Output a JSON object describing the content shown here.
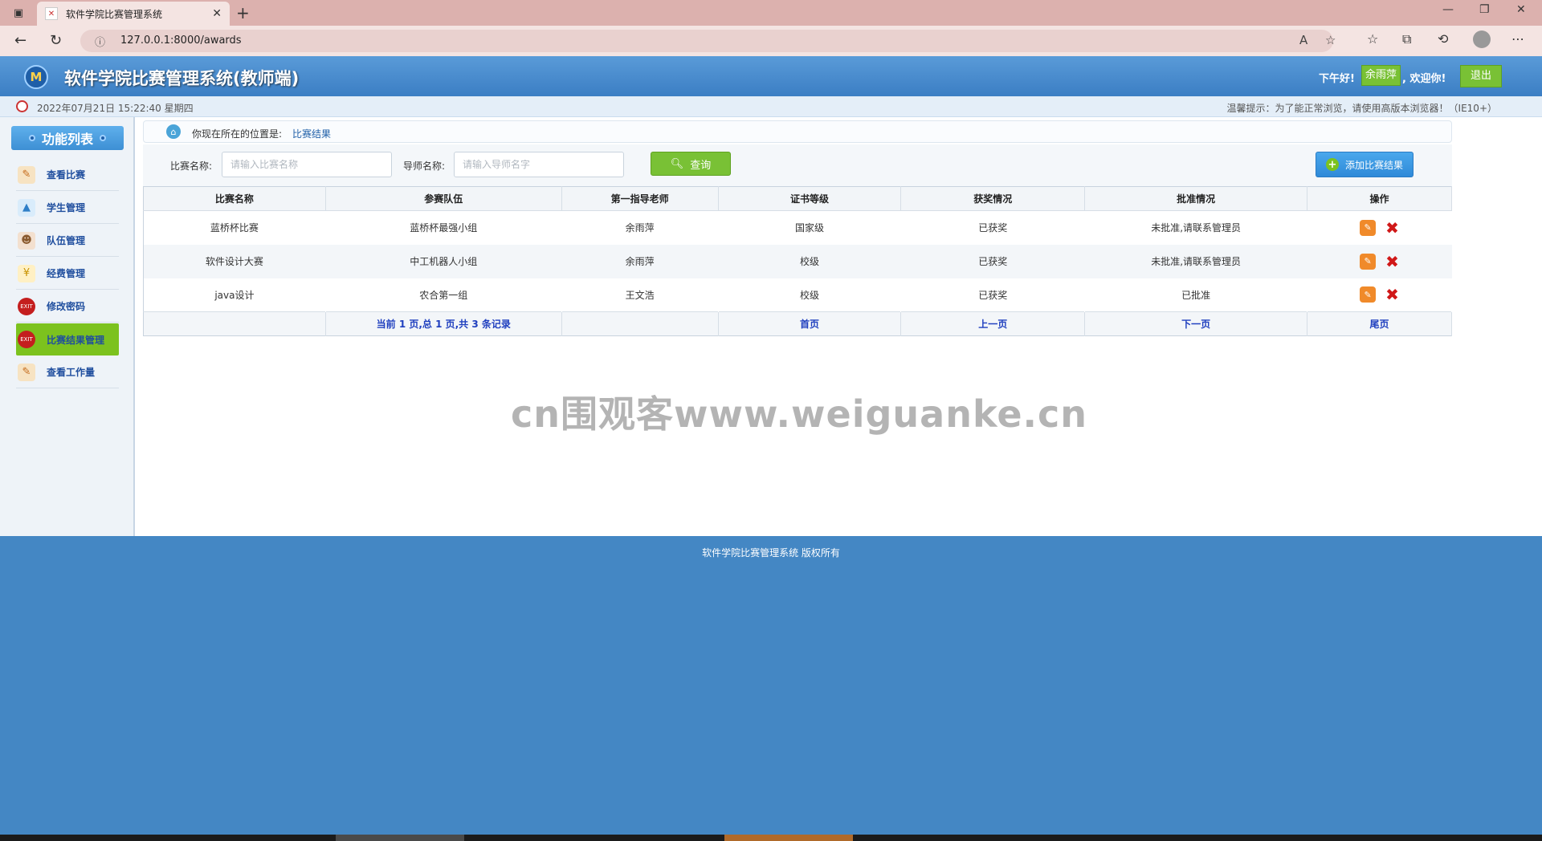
{
  "browser": {
    "tab_title": "软件学院比赛管理系统",
    "url": "127.0.0.1:8000/awards"
  },
  "header": {
    "logo_text": "M",
    "title": "软件学院比赛管理系统(教师端)",
    "greeting": "下午好!",
    "user_name": "余雨萍",
    "welcome": ", 欢迎你!",
    "logout_label": "退出"
  },
  "infobar": {
    "datetime": "2022年07月21日 15:22:40 星期四",
    "tip": "温馨提示：为了能正常浏览，请使用高版本浏览器！（IE10+）"
  },
  "sidebar": {
    "heading": "功能列表",
    "items": [
      {
        "label": "查看比赛",
        "icon": "book-icon"
      },
      {
        "label": "学生管理",
        "icon": "chart-icon"
      },
      {
        "label": "队伍管理",
        "icon": "users-icon"
      },
      {
        "label": "经费管理",
        "icon": "money-icon"
      },
      {
        "label": "修改密码",
        "icon": "exit-icon"
      },
      {
        "label": "比赛结果管理",
        "icon": "exit-icon"
      },
      {
        "label": "查看工作量",
        "icon": "book-icon"
      }
    ],
    "active_index": 5
  },
  "breadcrumb": {
    "prefix": "你现在所在的位置是:",
    "current": "比赛结果"
  },
  "search": {
    "contest_label": "比赛名称:",
    "contest_placeholder": "请输入比赛名称",
    "advisor_label": "导师名称:",
    "advisor_placeholder": "请输入导师名字",
    "query_label": "查询",
    "add_label": "添加比赛结果"
  },
  "table": {
    "headers": [
      "比赛名称",
      "参赛队伍",
      "第一指导老师",
      "证书等级",
      "获奖情况",
      "批准情况",
      "操作"
    ],
    "rows": [
      [
        "蓝桥杯比赛",
        "蓝桥杯最强小组",
        "余雨萍",
        "国家级",
        "已获奖",
        "未批准,请联系管理员"
      ],
      [
        "软件设计大赛",
        "中工机器人小组",
        "余雨萍",
        "校级",
        "已获奖",
        "未批准,请联系管理员"
      ],
      [
        "java设计",
        "农合第一组",
        "王文浩",
        "校级",
        "已获奖",
        "已批准"
      ]
    ],
    "pager": {
      "summary": "当前 1 页,总 1 页,共 3 条记录",
      "first": "首页",
      "prev": "上一页",
      "next": "下一页",
      "last": "尾页"
    }
  },
  "watermark": "cn围观客www.weiguanke.cn",
  "footer": "软件学院比赛管理系统 版权所有",
  "colors": {
    "header_blue": "#3b7ec4",
    "accent_green": "#79c135",
    "page_bg": "#4487c4",
    "link_blue": "#1f5fa8"
  }
}
